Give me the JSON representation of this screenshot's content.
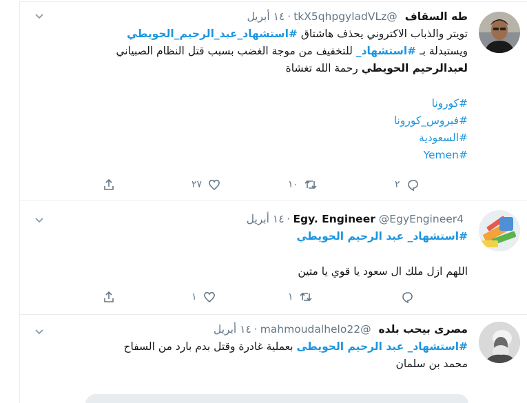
{
  "tweets": [
    {
      "name": "طه السقاف",
      "handle": "@tkX5qhpgyladVLz",
      "dot": "·",
      "date": "١٤ أبريل",
      "line1_pre": "تويتر والذباب الاكتروني يحذف هاشتاق ",
      "line1_tag": "#استشهاد_عبد_الرحيم_الحويطي",
      "line2_pre": "ويستبدلة بـ ",
      "line2_tag": "#استشهاد",
      "line2_tag_rest": "_",
      "line2_post": " للتخفيف من موجة الغضب بسبب قتل النظام الصبياني",
      "line3_bold": "لعبدالرحيم الحويطي",
      "line3_post": " رحمة الله تغشاة",
      "hashtags": [
        "#كورونا",
        "#فيروس_كورونا",
        "#السعودية",
        "#Yemen"
      ],
      "reply_count": "٢",
      "retweet_count": "١٠",
      "like_count": "٢٧"
    },
    {
      "name": "Egy. Engineer",
      "handle": "@EgyEngineer4",
      "dot": "·",
      "date": "١٤ أبريل",
      "tag_line": "#استشهاد_ عبد الرحيم الحويطي",
      "text": "اللهم ازل ملك ال سعود يا قوي يا متين",
      "reply_count": "",
      "retweet_count": "١",
      "like_count": "١"
    },
    {
      "name": "مصرى بيحب بلده",
      "handle": "@mahmoudalhelo22",
      "dot": "·",
      "date": "١٤ أبريل",
      "tag": "#استشهاد_ عبد الرحيم الحويطى",
      "text1": " بعملية غادرة وقتل بدم بارد من السفاح",
      "text2": "محمد بن سلمان"
    }
  ]
}
